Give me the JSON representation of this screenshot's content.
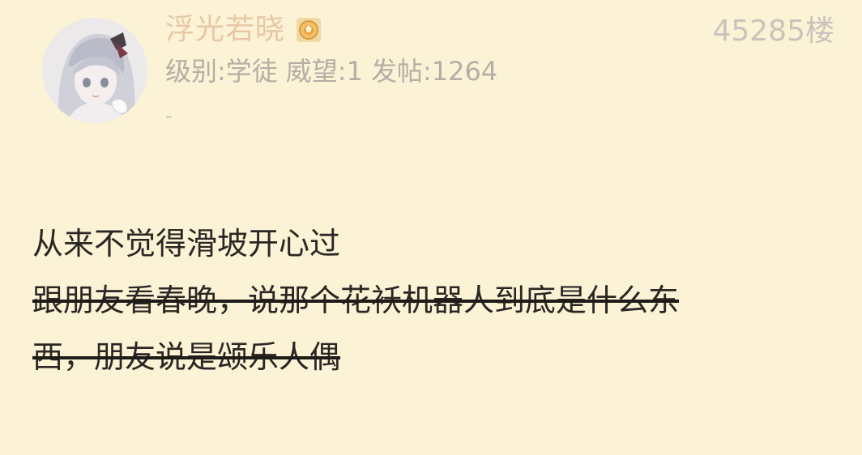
{
  "post": {
    "floor": "45285楼",
    "author": {
      "name": "浮光若晓",
      "level": "级别:学徒",
      "reputation": "威望:1",
      "post_count": "发帖:1264",
      "signature": "-"
    },
    "icons": {
      "avatar": "anime-character-avatar",
      "badge": "medal-badge-icon"
    },
    "content": {
      "line1": "从来不觉得滑坡开心过",
      "strikethrough_line1": "跟朋友看春晚，说那个花袄机器人到底是什么东",
      "strikethrough_line2": "西，朋友说是颂乐人偶"
    }
  },
  "colors": {
    "background": "#fcf3d6",
    "username": "#e8c8a4",
    "meta": "#b5aea5",
    "body_text": "#2a2623"
  }
}
